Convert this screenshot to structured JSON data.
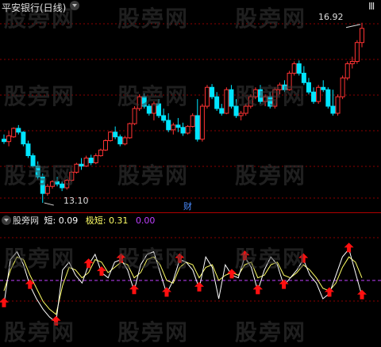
{
  "window": {
    "title": "平安银行(日线)",
    "corner_label": "Ⅲ"
  },
  "price_panel": {
    "high_label": "16.92",
    "low_label": "13.10",
    "finance_badge": "财"
  },
  "indicator": {
    "name": "股旁网",
    "short_label": "短:",
    "short_value": "0.09",
    "long_label": "极短:",
    "long_value": "0.31",
    "zero_value": "0.00"
  },
  "watermark": "股旁网",
  "colors": {
    "up": "#ff3333",
    "down": "#00e5ff",
    "grid": "#8b0000",
    "line_short": "#ffffff",
    "line_long": "#ffff66",
    "midline": "#c040ff",
    "arrow": "#ff1010"
  },
  "chart_data": {
    "type": "candlestick",
    "series_candles": [
      [
        14.45,
        14.55,
        14.35,
        14.4
      ],
      [
        14.4,
        14.62,
        14.3,
        14.52
      ],
      [
        14.5,
        14.7,
        14.48,
        14.68
      ],
      [
        14.68,
        14.75,
        14.55,
        14.6
      ],
      [
        14.6,
        14.62,
        14.3,
        14.35
      ],
      [
        14.35,
        14.42,
        14.05,
        14.1
      ],
      [
        14.1,
        14.15,
        13.85,
        13.88
      ],
      [
        13.88,
        13.98,
        13.6,
        13.65
      ],
      [
        13.65,
        13.72,
        13.1,
        13.3
      ],
      [
        13.3,
        13.5,
        13.25,
        13.45
      ],
      [
        13.45,
        13.58,
        13.4,
        13.55
      ],
      [
        13.55,
        13.65,
        13.45,
        13.5
      ],
      [
        13.5,
        13.55,
        13.35,
        13.42
      ],
      [
        13.42,
        13.6,
        13.38,
        13.58
      ],
      [
        13.58,
        13.78,
        13.55,
        13.75
      ],
      [
        13.75,
        13.95,
        13.72,
        13.92
      ],
      [
        13.92,
        14.05,
        13.8,
        13.88
      ],
      [
        13.88,
        14.1,
        13.86,
        14.05
      ],
      [
        14.05,
        14.12,
        13.9,
        13.95
      ],
      [
        13.95,
        14.15,
        13.92,
        14.1
      ],
      [
        14.1,
        14.25,
        14.08,
        14.22
      ],
      [
        14.22,
        14.45,
        14.2,
        14.42
      ],
      [
        14.42,
        14.62,
        14.4,
        14.6
      ],
      [
        14.6,
        14.72,
        14.45,
        14.5
      ],
      [
        14.5,
        14.55,
        14.3,
        14.35
      ],
      [
        14.35,
        14.52,
        14.32,
        14.48
      ],
      [
        14.48,
        14.8,
        14.46,
        14.78
      ],
      [
        14.78,
        15.15,
        14.75,
        15.1
      ],
      [
        15.1,
        15.4,
        15.05,
        15.35
      ],
      [
        15.35,
        15.42,
        15.1,
        15.15
      ],
      [
        15.15,
        15.2,
        14.95,
        15.0
      ],
      [
        15.0,
        15.25,
        14.85,
        15.2
      ],
      [
        15.2,
        15.3,
        14.9,
        14.95
      ],
      [
        14.95,
        15.1,
        14.8,
        14.85
      ],
      [
        14.85,
        15.0,
        14.6,
        14.65
      ],
      [
        14.65,
        14.8,
        14.55,
        14.75
      ],
      [
        14.75,
        14.9,
        14.6,
        14.7
      ],
      [
        14.7,
        14.8,
        14.52,
        14.58
      ],
      [
        14.58,
        14.75,
        14.55,
        14.72
      ],
      [
        14.72,
        15.0,
        14.7,
        14.95
      ],
      [
        14.95,
        15.3,
        14.4,
        14.45
      ],
      [
        14.45,
        15.2,
        14.4,
        15.15
      ],
      [
        15.15,
        15.6,
        15.1,
        15.55
      ],
      [
        15.55,
        15.62,
        15.3,
        15.35
      ],
      [
        15.35,
        15.45,
        15.05,
        15.1
      ],
      [
        15.1,
        15.2,
        14.95,
        15.0
      ],
      [
        15.0,
        15.55,
        14.98,
        15.5
      ],
      [
        15.5,
        15.6,
        15.1,
        15.15
      ],
      [
        15.15,
        15.3,
        14.9,
        14.95
      ],
      [
        14.95,
        15.05,
        14.85,
        15.0
      ],
      [
        15.0,
        15.2,
        14.95,
        15.15
      ],
      [
        15.15,
        15.4,
        15.1,
        15.35
      ],
      [
        15.35,
        15.55,
        15.3,
        15.5
      ],
      [
        15.5,
        15.6,
        15.2,
        15.25
      ],
      [
        15.25,
        15.4,
        15.15,
        15.35
      ],
      [
        15.35,
        15.45,
        15.1,
        15.15
      ],
      [
        15.15,
        15.55,
        15.1,
        15.5
      ],
      [
        15.5,
        15.65,
        15.4,
        15.6
      ],
      [
        15.6,
        15.7,
        15.45,
        15.5
      ],
      [
        15.5,
        15.9,
        15.48,
        15.85
      ],
      [
        15.85,
        16.1,
        15.8,
        16.05
      ],
      [
        16.05,
        16.12,
        15.8,
        15.85
      ],
      [
        15.85,
        16.0,
        15.6,
        15.65
      ],
      [
        15.65,
        15.75,
        15.4,
        15.45
      ],
      [
        15.45,
        15.55,
        15.2,
        15.25
      ],
      [
        15.25,
        15.6,
        15.2,
        15.55
      ],
      [
        15.55,
        15.7,
        15.45,
        15.5
      ],
      [
        15.5,
        15.55,
        15.1,
        15.15
      ],
      [
        15.15,
        15.5,
        14.95,
        15.0
      ],
      [
        15.0,
        15.4,
        14.95,
        15.35
      ],
      [
        15.35,
        15.8,
        15.3,
        15.75
      ],
      [
        15.75,
        16.1,
        15.7,
        16.05
      ],
      [
        16.05,
        16.2,
        15.95,
        16.1
      ],
      [
        16.1,
        16.55,
        16.05,
        16.5
      ],
      [
        16.5,
        16.92,
        16.4,
        16.8
      ]
    ],
    "indicator_short": [
      -0.45,
      0.4,
      0.55,
      0.3,
      -0.1,
      -0.35,
      -0.55,
      -0.7,
      -0.8,
      0.2,
      0.35,
      0.1,
      -0.05,
      0.3,
      0.5,
      0.15,
      0.05,
      0.35,
      0.4,
      0.2,
      -0.2,
      0.3,
      0.5,
      0.55,
      0.15,
      -0.25,
      0.0,
      0.4,
      0.35,
      0.2,
      -0.15,
      0.45,
      0.25,
      -0.35,
      0.3,
      0.1,
      0.05,
      0.45,
      0.25,
      -0.2,
      0.2,
      0.45,
      0.3,
      -0.1,
      0.05,
      0.2,
      0.4,
      0.1,
      -0.05,
      -0.35,
      -0.25,
      0.1,
      0.45,
      0.6,
      0.15,
      -0.3
    ],
    "indicator_long": [
      -0.2,
      0.2,
      0.45,
      0.4,
      0.1,
      -0.15,
      -0.4,
      -0.55,
      -0.65,
      -0.1,
      0.25,
      0.2,
      0.05,
      0.15,
      0.4,
      0.35,
      0.15,
      0.25,
      0.35,
      0.3,
      0.05,
      0.15,
      0.4,
      0.45,
      0.3,
      0.0,
      -0.05,
      0.25,
      0.35,
      0.3,
      0.05,
      0.25,
      0.3,
      0.0,
      0.1,
      0.15,
      0.1,
      0.3,
      0.35,
      0.05,
      0.1,
      0.3,
      0.35,
      0.1,
      0.05,
      0.15,
      0.3,
      0.2,
      0.05,
      -0.15,
      -0.2,
      -0.05,
      0.25,
      0.45,
      0.35,
      0.05
    ],
    "arrow_positions": [
      0,
      6,
      11,
      17,
      20,
      24,
      27,
      33,
      36,
      40,
      47,
      50,
      52,
      53,
      58,
      62,
      67,
      71,
      74
    ],
    "price_range": [
      13.0,
      17.1
    ],
    "indicator_range": [
      -1.0,
      1.0
    ]
  }
}
